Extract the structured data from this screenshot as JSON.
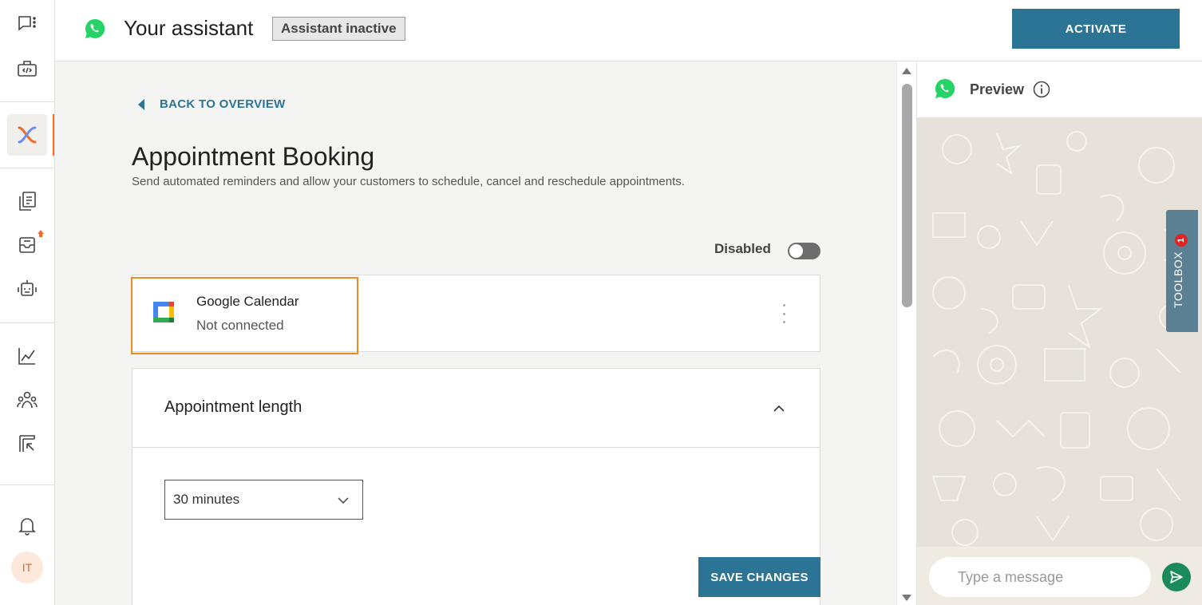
{
  "header": {
    "title": "Your assistant",
    "status_badge": "Assistant inactive",
    "activate_label": "ACTIVATE"
  },
  "sidebar": {
    "items": [
      {
        "name": "conversations",
        "icon": "chat-list-icon"
      },
      {
        "name": "developer",
        "icon": "code-toolbox-icon"
      },
      {
        "name": "ai-assistant",
        "icon": "brand-x-icon",
        "active": true
      },
      {
        "name": "knowledge",
        "icon": "documents-icon"
      },
      {
        "name": "inbox",
        "icon": "inbox-upload-icon"
      },
      {
        "name": "bots",
        "icon": "robot-icon"
      },
      {
        "name": "analytics",
        "icon": "line-chart-icon"
      },
      {
        "name": "contacts",
        "icon": "people-icon"
      },
      {
        "name": "reports",
        "icon": "report-icon"
      },
      {
        "name": "notifications",
        "icon": "bell-icon"
      }
    ],
    "avatar_initials": "IT"
  },
  "main": {
    "back_label": "BACK TO OVERVIEW",
    "heading": "Appointment Booking",
    "description": "Send automated reminders and allow your customers to schedule, cancel and reschedule appointments.",
    "toggle_label": "Disabled",
    "toggle_on": false,
    "calendar": {
      "name": "Google Calendar",
      "status": "Not connected"
    },
    "appointment_length": {
      "title": "Appointment length",
      "selected": "30 minutes"
    },
    "save_label": "SAVE CHANGES"
  },
  "preview": {
    "title": "Preview",
    "message_placeholder": "Type a message"
  },
  "toolbox": {
    "label": "TOOLBOX",
    "count": "1"
  },
  "colors": {
    "primary": "#2c7495",
    "accent": "#ff6a13",
    "highlight": "#f08a24",
    "whatsapp": "#25d366"
  }
}
